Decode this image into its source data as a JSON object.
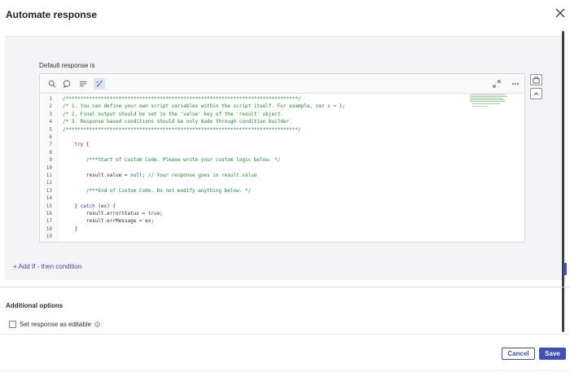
{
  "dialog": {
    "title": "Automate response"
  },
  "default_response": {
    "label": "Default response is"
  },
  "editor": {
    "toolbar_icons": [
      "search-icon",
      "comment-icon",
      "format-icon",
      "magic-icon",
      "expand-icon",
      "more-icon"
    ],
    "line_numbers": [
      "1",
      "2",
      "3",
      "4",
      "5",
      "6",
      "7",
      "8",
      "9",
      "10",
      "11",
      "12",
      "13",
      "14",
      "15",
      "16",
      "17",
      "18",
      "19"
    ],
    "lines": [
      [
        {
          "t": "c",
          "v": "/*******************************************************************************/"
        }
      ],
      [
        {
          "t": "c",
          "v": "/* 1. You can define your own script variables within the script itself. For example, var x = 1;"
        }
      ],
      [
        {
          "t": "c",
          "v": "/* 2. Final output should be set in the 'value' key of the 'result' object."
        }
      ],
      [
        {
          "t": "c",
          "v": "/* 3. Response based conditions should be only made through condition builder."
        }
      ],
      [
        {
          "t": "c",
          "v": "/*******************************************************************************/"
        }
      ],
      [
        {
          "t": "p",
          "v": ""
        }
      ],
      [
        {
          "t": "p",
          "v": "    "
        },
        {
          "t": "k",
          "v": "try"
        },
        {
          "t": "p",
          "v": " {"
        }
      ],
      [
        {
          "t": "p",
          "v": ""
        }
      ],
      [
        {
          "t": "p",
          "v": "        "
        },
        {
          "t": "c",
          "v": "/***Start of Custom Code. Please write your custom logic below. */"
        }
      ],
      [
        {
          "t": "p",
          "v": ""
        }
      ],
      [
        {
          "t": "p",
          "v": "        result.value = "
        },
        {
          "t": "k",
          "v": "null"
        },
        {
          "t": "p",
          "v": "; "
        },
        {
          "t": "c",
          "v": "// Your response goes in result.value"
        }
      ],
      [
        {
          "t": "p",
          "v": ""
        }
      ],
      [
        {
          "t": "p",
          "v": "        "
        },
        {
          "t": "c",
          "v": "/***End of Custom Code. Do not modify anything below. */"
        }
      ],
      [
        {
          "t": "p",
          "v": ""
        }
      ],
      [
        {
          "t": "p",
          "v": "    } "
        },
        {
          "t": "k",
          "v": "catch"
        },
        {
          "t": "p",
          "v": " (ex) {"
        }
      ],
      [
        {
          "t": "p",
          "v": "        result.errorStatus = "
        },
        {
          "t": "k",
          "v": "true"
        },
        {
          "t": "p",
          "v": ";"
        }
      ],
      [
        {
          "t": "p",
          "v": "        result.errMessage = ex;"
        }
      ],
      [
        {
          "t": "p",
          "v": "    }"
        }
      ],
      [
        {
          "t": "p",
          "v": ""
        }
      ]
    ]
  },
  "add_condition": {
    "label": "+ Add If - then condition"
  },
  "additional_options": {
    "title": "Additional options",
    "checkbox_label": "Set response as editable",
    "checked": false
  },
  "footer": {
    "cancel_label": "Cancel",
    "save_label": "Save"
  },
  "colors": {
    "accent": "#3f51b5",
    "comment": "#1e8a2e",
    "keyword": "#1c3fbf"
  }
}
